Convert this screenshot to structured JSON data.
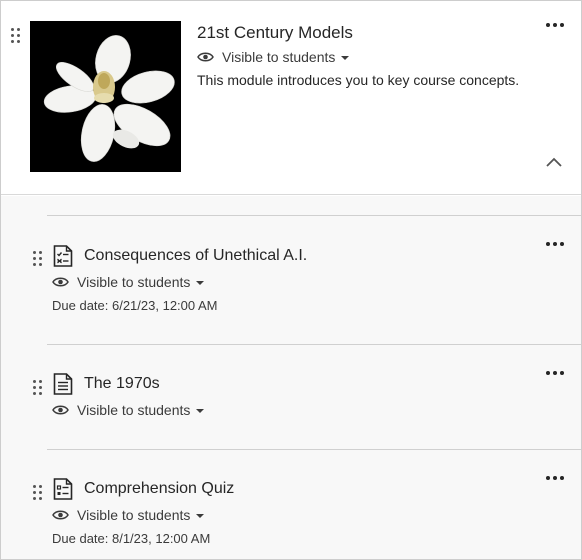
{
  "module": {
    "title": "21st Century Models",
    "visibility": "Visible to students",
    "description": "This module introduces you to key course concepts."
  },
  "items": [
    {
      "title": "Consequences of Unethical A.I.",
      "icon": "assignment-icon",
      "visibility": "Visible to students",
      "due": "Due date: 6/21/23, 12:00 AM"
    },
    {
      "title": "The 1970s",
      "icon": "document-icon",
      "visibility": "Visible to students"
    },
    {
      "title": "Comprehension Quiz",
      "icon": "quiz-icon",
      "visibility": "Visible to students",
      "due": "Due date: 8/1/23, 12:00 AM"
    }
  ],
  "colors": {
    "text": "#262626",
    "content_background": "#f8f8f8",
    "divider": "#d0d0d0"
  }
}
